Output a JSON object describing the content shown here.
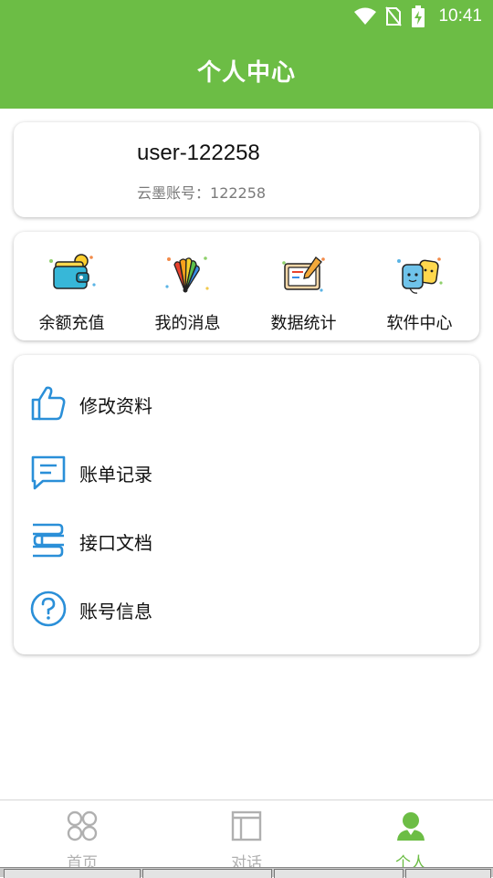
{
  "status_bar": {
    "time": "10:41",
    "icons": [
      "wifi-icon",
      "no-sim-icon",
      "battery-charging-icon"
    ]
  },
  "header": {
    "title": "个人中心"
  },
  "profile": {
    "username": "user-122258",
    "account_label": "云墨账号：",
    "account_number": "122258"
  },
  "quick_actions": [
    {
      "label": "余额充值",
      "icon": "wallet-icon"
    },
    {
      "label": "我的消息",
      "icon": "color-palette-icon"
    },
    {
      "label": "数据统计",
      "icon": "chart-board-icon"
    },
    {
      "label": "软件中心",
      "icon": "software-chips-icon"
    }
  ],
  "menu": [
    {
      "label": "修改资料",
      "icon": "thumbs-up-icon"
    },
    {
      "label": "账单记录",
      "icon": "message-icon"
    },
    {
      "label": "接口文档",
      "icon": "books-icon"
    },
    {
      "label": "账号信息",
      "icon": "question-icon"
    }
  ],
  "bottom_nav": [
    {
      "label": "首页",
      "icon": "home-grid-icon",
      "active": false
    },
    {
      "label": "对话",
      "icon": "layout-icon",
      "active": false
    },
    {
      "label": "个人",
      "icon": "person-icon",
      "active": true
    }
  ],
  "colors": {
    "accent": "#6cbd45",
    "menu_icon": "#2a8fd8",
    "inactive": "#b0b0b0"
  }
}
